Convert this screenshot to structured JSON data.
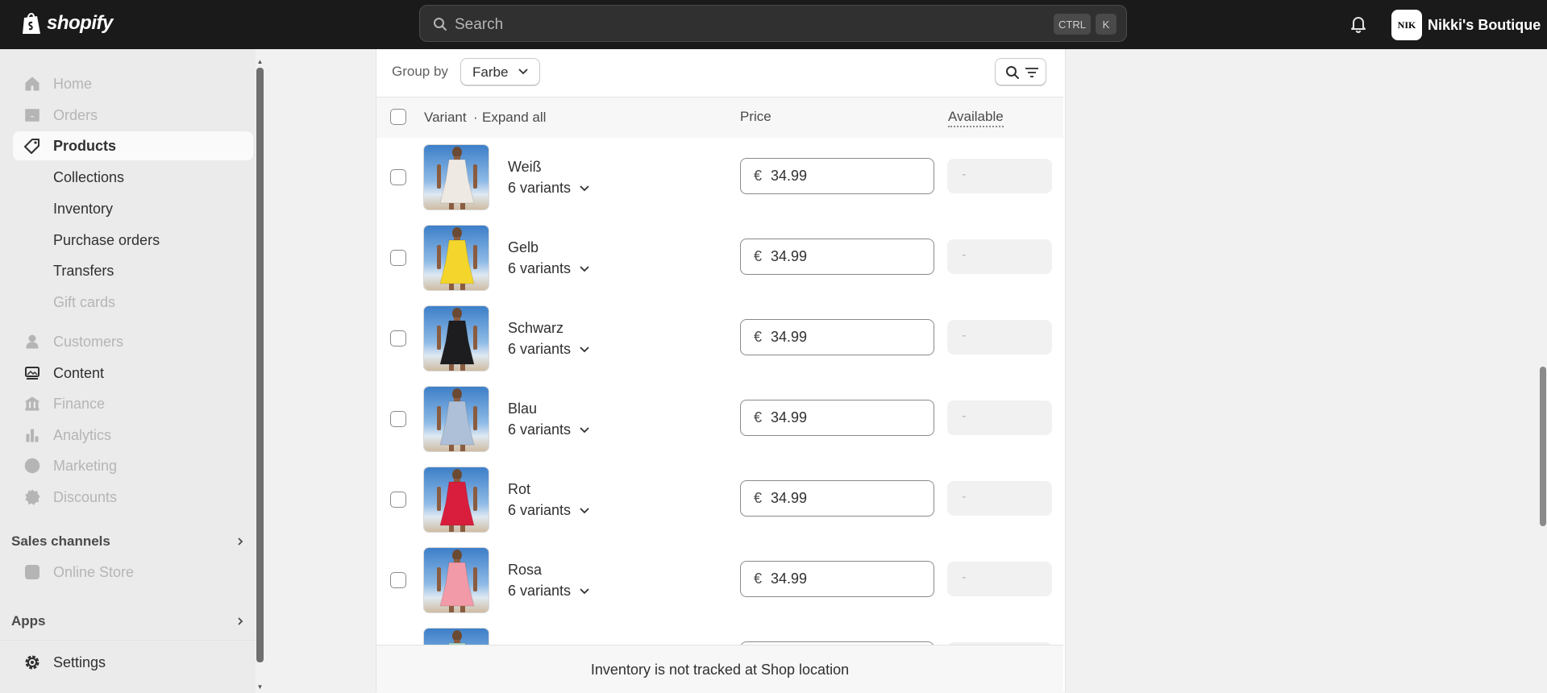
{
  "topbar": {
    "logo_text": "shopify",
    "search_placeholder": "Search",
    "shortcut_ctrl": "CTRL",
    "shortcut_key": "K",
    "store_avatar": "NIK",
    "store_name": "Nikki's Boutique"
  },
  "sidebar": {
    "items": [
      {
        "label": "Home",
        "icon": "home-icon",
        "state": "disabled"
      },
      {
        "label": "Orders",
        "icon": "inbox-icon",
        "state": "disabled"
      },
      {
        "label": "Products",
        "icon": "tag-icon",
        "state": "selected"
      },
      {
        "label": "Collections",
        "state": "sub"
      },
      {
        "label": "Inventory",
        "state": "sub"
      },
      {
        "label": "Purchase orders",
        "state": "sub"
      },
      {
        "label": "Transfers",
        "state": "sub"
      },
      {
        "label": "Gift cards",
        "state": "sub-disabled"
      },
      {
        "label": "Customers",
        "icon": "person-icon",
        "state": "disabled"
      },
      {
        "label": "Content",
        "icon": "image-icon",
        "state": "active"
      },
      {
        "label": "Finance",
        "icon": "bank-icon",
        "state": "disabled"
      },
      {
        "label": "Analytics",
        "icon": "bar-chart-icon",
        "state": "disabled"
      },
      {
        "label": "Marketing",
        "icon": "target-icon",
        "state": "disabled"
      },
      {
        "label": "Discounts",
        "icon": "discount-icon",
        "state": "disabled"
      }
    ],
    "sales_channels_label": "Sales channels",
    "online_store_label": "Online Store",
    "apps_label": "Apps",
    "settings_label": "Settings"
  },
  "toolbar": {
    "group_by_label": "Group by",
    "group_by_value": "Farbe"
  },
  "table": {
    "col_variant": "Variant",
    "col_separator": "·",
    "expand_all": "Expand all",
    "col_price": "Price",
    "col_available": "Available",
    "currency": "€",
    "rows": [
      {
        "name": "Weiß",
        "variants": "6 variants",
        "price": "34.99",
        "available": "-",
        "color": "#efe9e4"
      },
      {
        "name": "Gelb",
        "variants": "6 variants",
        "price": "34.99",
        "available": "-",
        "color": "#f4d52b"
      },
      {
        "name": "Schwarz",
        "variants": "6 variants",
        "price": "34.99",
        "available": "-",
        "color": "#1d1d1f"
      },
      {
        "name": "Blau",
        "variants": "6 variants",
        "price": "34.99",
        "available": "-",
        "color": "#aebfd8"
      },
      {
        "name": "Rot",
        "variants": "6 variants",
        "price": "34.99",
        "available": "-",
        "color": "#d81e3c"
      },
      {
        "name": "Rosa",
        "variants": "6 variants",
        "price": "34.99",
        "available": "-",
        "color": "#f29aa8"
      },
      {
        "name": "",
        "variants": "",
        "price": "",
        "available": "",
        "color": "#a7d8c8"
      }
    ],
    "footer_note": "Inventory is not tracked at Shop location"
  }
}
